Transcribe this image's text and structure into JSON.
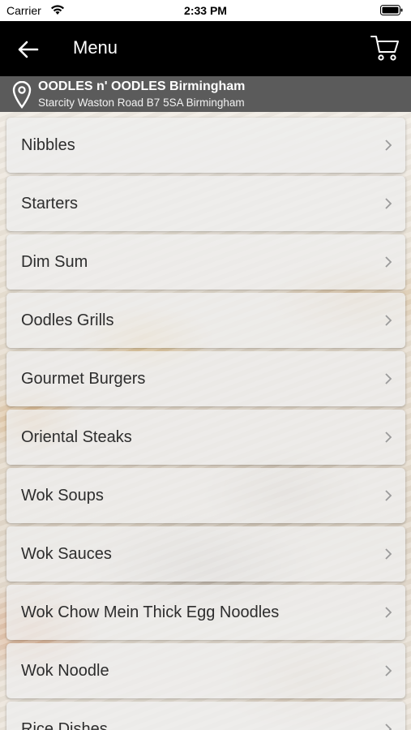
{
  "status_bar": {
    "carrier": "Carrier",
    "time": "2:33 PM"
  },
  "nav": {
    "title": "Menu"
  },
  "location": {
    "name": "OODLES n' OODLES Birmingham",
    "address": "Starcity Waston Road B7 5SA Birmingham"
  },
  "menu": {
    "items": [
      {
        "label": "Nibbles"
      },
      {
        "label": "Starters"
      },
      {
        "label": "Dim Sum"
      },
      {
        "label": "Oodles Grills"
      },
      {
        "label": "Gourmet Burgers"
      },
      {
        "label": "Oriental Steaks"
      },
      {
        "label": "Wok Soups"
      },
      {
        "label": "Wok Sauces"
      },
      {
        "label": "Wok Chow Mein Thick Egg Noodles"
      },
      {
        "label": "Wok Noodle"
      },
      {
        "label": "Rice Dishes"
      }
    ]
  }
}
